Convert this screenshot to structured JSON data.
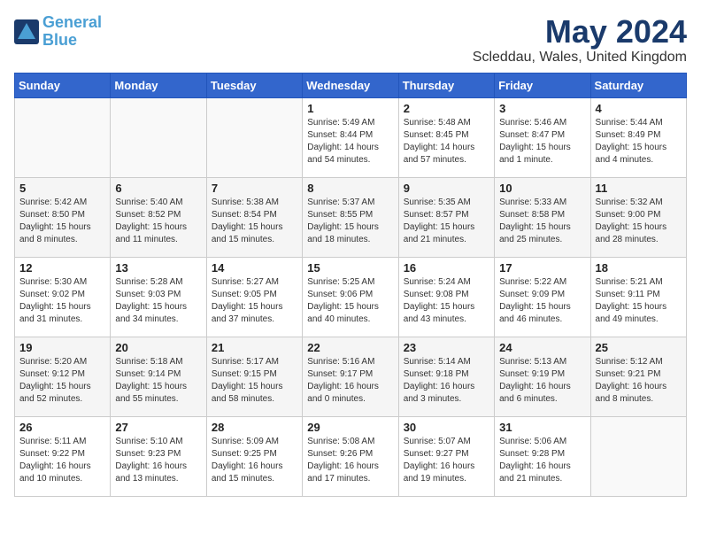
{
  "logo": {
    "line1": "General",
    "line2": "Blue"
  },
  "title": "May 2024",
  "subtitle": "Scleddau, Wales, United Kingdom",
  "days_of_week": [
    "Sunday",
    "Monday",
    "Tuesday",
    "Wednesday",
    "Thursday",
    "Friday",
    "Saturday"
  ],
  "weeks": [
    [
      {
        "day": "",
        "info": ""
      },
      {
        "day": "",
        "info": ""
      },
      {
        "day": "",
        "info": ""
      },
      {
        "day": "1",
        "info": "Sunrise: 5:49 AM\nSunset: 8:44 PM\nDaylight: 14 hours\nand 54 minutes."
      },
      {
        "day": "2",
        "info": "Sunrise: 5:48 AM\nSunset: 8:45 PM\nDaylight: 14 hours\nand 57 minutes."
      },
      {
        "day": "3",
        "info": "Sunrise: 5:46 AM\nSunset: 8:47 PM\nDaylight: 15 hours\nand 1 minute."
      },
      {
        "day": "4",
        "info": "Sunrise: 5:44 AM\nSunset: 8:49 PM\nDaylight: 15 hours\nand 4 minutes."
      }
    ],
    [
      {
        "day": "5",
        "info": "Sunrise: 5:42 AM\nSunset: 8:50 PM\nDaylight: 15 hours\nand 8 minutes."
      },
      {
        "day": "6",
        "info": "Sunrise: 5:40 AM\nSunset: 8:52 PM\nDaylight: 15 hours\nand 11 minutes."
      },
      {
        "day": "7",
        "info": "Sunrise: 5:38 AM\nSunset: 8:54 PM\nDaylight: 15 hours\nand 15 minutes."
      },
      {
        "day": "8",
        "info": "Sunrise: 5:37 AM\nSunset: 8:55 PM\nDaylight: 15 hours\nand 18 minutes."
      },
      {
        "day": "9",
        "info": "Sunrise: 5:35 AM\nSunset: 8:57 PM\nDaylight: 15 hours\nand 21 minutes."
      },
      {
        "day": "10",
        "info": "Sunrise: 5:33 AM\nSunset: 8:58 PM\nDaylight: 15 hours\nand 25 minutes."
      },
      {
        "day": "11",
        "info": "Sunrise: 5:32 AM\nSunset: 9:00 PM\nDaylight: 15 hours\nand 28 minutes."
      }
    ],
    [
      {
        "day": "12",
        "info": "Sunrise: 5:30 AM\nSunset: 9:02 PM\nDaylight: 15 hours\nand 31 minutes."
      },
      {
        "day": "13",
        "info": "Sunrise: 5:28 AM\nSunset: 9:03 PM\nDaylight: 15 hours\nand 34 minutes."
      },
      {
        "day": "14",
        "info": "Sunrise: 5:27 AM\nSunset: 9:05 PM\nDaylight: 15 hours\nand 37 minutes."
      },
      {
        "day": "15",
        "info": "Sunrise: 5:25 AM\nSunset: 9:06 PM\nDaylight: 15 hours\nand 40 minutes."
      },
      {
        "day": "16",
        "info": "Sunrise: 5:24 AM\nSunset: 9:08 PM\nDaylight: 15 hours\nand 43 minutes."
      },
      {
        "day": "17",
        "info": "Sunrise: 5:22 AM\nSunset: 9:09 PM\nDaylight: 15 hours\nand 46 minutes."
      },
      {
        "day": "18",
        "info": "Sunrise: 5:21 AM\nSunset: 9:11 PM\nDaylight: 15 hours\nand 49 minutes."
      }
    ],
    [
      {
        "day": "19",
        "info": "Sunrise: 5:20 AM\nSunset: 9:12 PM\nDaylight: 15 hours\nand 52 minutes."
      },
      {
        "day": "20",
        "info": "Sunrise: 5:18 AM\nSunset: 9:14 PM\nDaylight: 15 hours\nand 55 minutes."
      },
      {
        "day": "21",
        "info": "Sunrise: 5:17 AM\nSunset: 9:15 PM\nDaylight: 15 hours\nand 58 minutes."
      },
      {
        "day": "22",
        "info": "Sunrise: 5:16 AM\nSunset: 9:17 PM\nDaylight: 16 hours\nand 0 minutes."
      },
      {
        "day": "23",
        "info": "Sunrise: 5:14 AM\nSunset: 9:18 PM\nDaylight: 16 hours\nand 3 minutes."
      },
      {
        "day": "24",
        "info": "Sunrise: 5:13 AM\nSunset: 9:19 PM\nDaylight: 16 hours\nand 6 minutes."
      },
      {
        "day": "25",
        "info": "Sunrise: 5:12 AM\nSunset: 9:21 PM\nDaylight: 16 hours\nand 8 minutes."
      }
    ],
    [
      {
        "day": "26",
        "info": "Sunrise: 5:11 AM\nSunset: 9:22 PM\nDaylight: 16 hours\nand 10 minutes."
      },
      {
        "day": "27",
        "info": "Sunrise: 5:10 AM\nSunset: 9:23 PM\nDaylight: 16 hours\nand 13 minutes."
      },
      {
        "day": "28",
        "info": "Sunrise: 5:09 AM\nSunset: 9:25 PM\nDaylight: 16 hours\nand 15 minutes."
      },
      {
        "day": "29",
        "info": "Sunrise: 5:08 AM\nSunset: 9:26 PM\nDaylight: 16 hours\nand 17 minutes."
      },
      {
        "day": "30",
        "info": "Sunrise: 5:07 AM\nSunset: 9:27 PM\nDaylight: 16 hours\nand 19 minutes."
      },
      {
        "day": "31",
        "info": "Sunrise: 5:06 AM\nSunset: 9:28 PM\nDaylight: 16 hours\nand 21 minutes."
      },
      {
        "day": "",
        "info": ""
      }
    ]
  ]
}
